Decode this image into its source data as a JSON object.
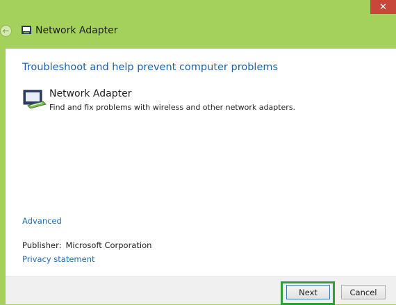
{
  "window": {
    "title": "Network Adapter",
    "close_glyph": "✕",
    "back_glyph": "←",
    "accent_color": "#a4d05c"
  },
  "main": {
    "heading": "Troubleshoot and help prevent computer problems",
    "item": {
      "title": "Network Adapter",
      "description": "Find and fix problems with wireless and other network adapters.",
      "icon": "network-adapter-icon"
    },
    "advanced_link": "Advanced",
    "publisher_label": "Publisher:",
    "publisher_value": "Microsoft Corporation",
    "privacy_link": "Privacy statement"
  },
  "footer": {
    "next_label": "Next",
    "cancel_label": "Cancel",
    "highlight_color": "#2aa135"
  }
}
